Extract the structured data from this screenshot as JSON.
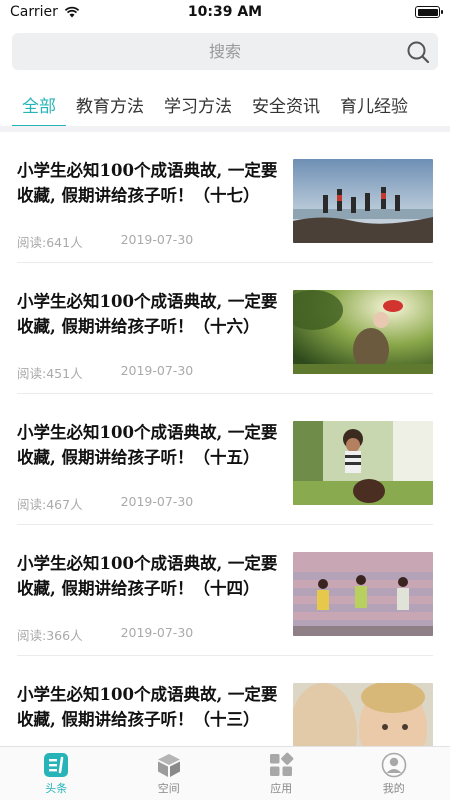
{
  "status_bar": {
    "carrier": "Carrier",
    "time": "10:39 AM"
  },
  "search": {
    "placeholder": "搜索"
  },
  "tabs": [
    {
      "label": "全部",
      "active": true
    },
    {
      "label": "教育方法"
    },
    {
      "label": "学习方法"
    },
    {
      "label": "安全资讯"
    },
    {
      "label": "育儿经验"
    }
  ],
  "articles": [
    {
      "title": "小学生必知100个成语典故, 一定要收藏, 假期讲给孩子听！（十七）",
      "reads": "阅读:641人",
      "date": "2019-07-30"
    },
    {
      "title": "小学生必知100个成语典故, 一定要收藏, 假期讲给孩子听！（十六）",
      "reads": "阅读:451人",
      "date": "2019-07-30"
    },
    {
      "title": "小学生必知100个成语典故, 一定要收藏, 假期讲给孩子听！（十五）",
      "reads": "阅读:467人",
      "date": "2019-07-30"
    },
    {
      "title": "小学生必知100个成语典故, 一定要收藏, 假期讲给孩子听！（十四）",
      "reads": "阅读:366人",
      "date": "2019-07-30"
    },
    {
      "title": "小学生必知100个成语典故, 一定要收藏, 假期讲给孩子听！（十三）",
      "reads": "",
      "date": ""
    }
  ],
  "tabbar": [
    {
      "label": "头条",
      "icon": "headlines-icon",
      "active": true
    },
    {
      "label": "空间",
      "icon": "cube-icon"
    },
    {
      "label": "应用",
      "icon": "apps-icon"
    },
    {
      "label": "我的",
      "icon": "profile-icon"
    }
  ],
  "colors": {
    "accent": "#27b4b9",
    "tab_text": "#333333",
    "meta_text": "#aaaaaa"
  }
}
